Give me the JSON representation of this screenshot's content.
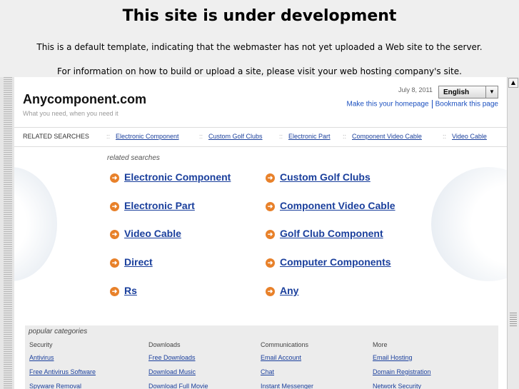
{
  "notice": {
    "title": "This site is under development",
    "line1": "This is a default template, indicating that the webmaster has not yet uploaded a Web site to the server.",
    "line2": "For information on how to build or upload a site, please visit your web hosting company's site."
  },
  "site": {
    "name": "Anycomponent.com",
    "tagline": "What you need, when you need it",
    "date": "July 8, 2011",
    "language": "English",
    "make_homepage": "Make this your homepage",
    "bookmark": "Bookmark this page"
  },
  "related_bar": {
    "label": "RELATED SEARCHES",
    "separator": "::",
    "items": [
      "Electronic Component",
      "Custom Golf Clubs",
      "Electronic Part",
      "Component Video Cable",
      "Video Cable"
    ]
  },
  "related": {
    "label": "related searches",
    "links": [
      "Electronic Component",
      "Custom Golf Clubs",
      "Electronic Part",
      "Component Video Cable",
      "Video Cable",
      "Golf Club Component",
      "Direct",
      "Computer Components",
      "Rs",
      "Any"
    ]
  },
  "popular": {
    "title": "popular categories",
    "columns": [
      {
        "head": "Security",
        "links": [
          "Antivirus",
          "Free Antivirus Software",
          "Spyware Removal"
        ]
      },
      {
        "head": "Downloads",
        "links": [
          "Free Downloads",
          "Download Music",
          "Download Full Movie"
        ]
      },
      {
        "head": "Communications",
        "links": [
          "Email Account",
          "Chat",
          "Instant Messenger"
        ]
      },
      {
        "head": "More",
        "links": [
          "Email Hosting",
          "Domain Registration",
          "Network Security"
        ]
      }
    ]
  },
  "colors": {
    "link": "#1a3f9c",
    "bullet": "#e8812a",
    "page_bg": "#efefef"
  }
}
